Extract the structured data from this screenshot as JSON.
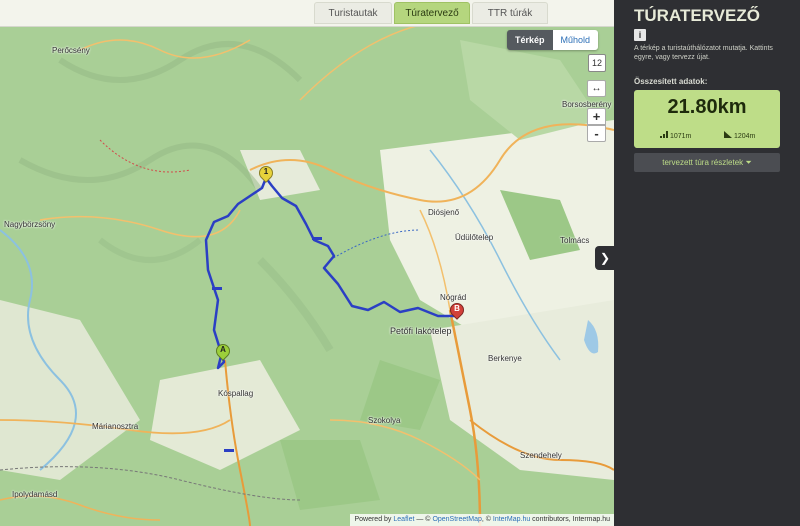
{
  "tabs": [
    {
      "label": "Turistautak"
    },
    {
      "label": "Túratervező"
    },
    {
      "label": "TTR túrák"
    }
  ],
  "map": {
    "layer_map": "Térkép",
    "layer_satellite": "Műhold",
    "zoom_level": "12",
    "fullscreen_icon": "↔",
    "zoom_in": "+",
    "zoom_out": "-",
    "places": [
      {
        "name": "Perőcsény"
      },
      {
        "name": "Nagybörzsöny"
      },
      {
        "name": "Diósjenő"
      },
      {
        "name": "Üdülőtelep"
      },
      {
        "name": "Tolmács"
      },
      {
        "name": "Nógrád"
      },
      {
        "name": "Petőfi lakótelep"
      },
      {
        "name": "Berkenye"
      },
      {
        "name": "Kóspallag"
      },
      {
        "name": "Márianosztra"
      },
      {
        "name": "Ipolydamásd"
      },
      {
        "name": "Szendehely"
      },
      {
        "name": "Borsosberény"
      },
      {
        "name": "Szokolya"
      }
    ],
    "markers": {
      "start": "A",
      "waypoint": "1",
      "end": "B"
    },
    "route_color": "#2b3fc4",
    "attribution": {
      "prefix": "Powered by",
      "leaflet": "Leaflet",
      "sep1": " — ©",
      "osm": "OpenStreetMap",
      "sep2": ", ©",
      "intermap": "InterMap.hu",
      "suffix": " contributors, Intermap.hu"
    }
  },
  "sidebar": {
    "title": "TÚRATERVEZŐ",
    "info_icon": "i",
    "description": "A térkép a turistaúthálózatot mutatja. Kattints egyre, vagy tervezz újat.",
    "stats_label": "Összesített adatok:",
    "distance": "21.80km",
    "ascent": "1071m",
    "descent": "1204m",
    "details_button": "tervezett túra részletek",
    "toggle_icon": "❯",
    "accent": "#bedd88"
  }
}
